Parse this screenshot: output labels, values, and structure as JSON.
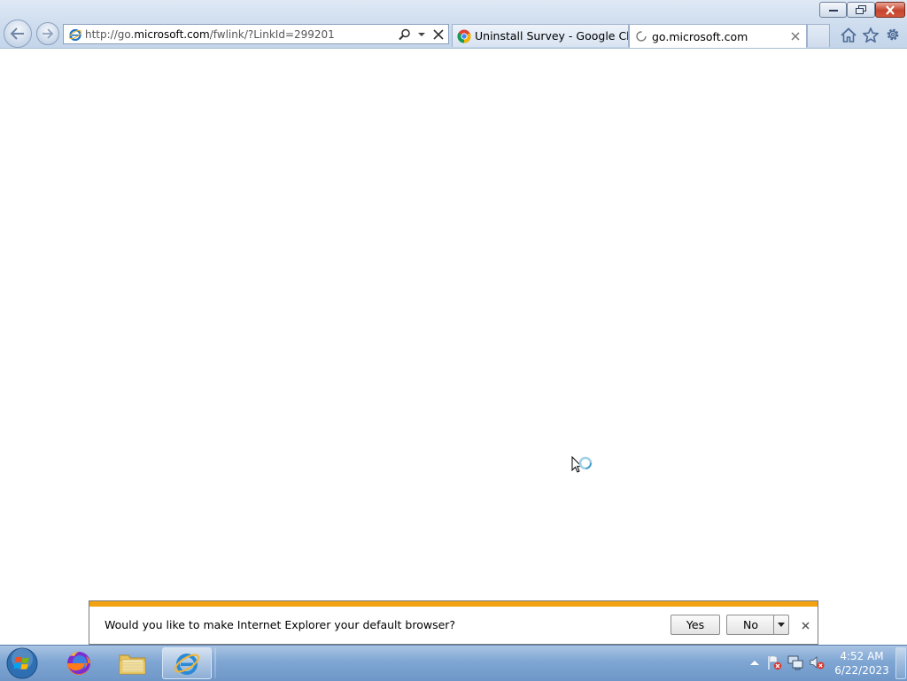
{
  "window": {
    "controls": [
      "minimize",
      "restore",
      "close"
    ]
  },
  "addressbar": {
    "url_prefix": "http://go.",
    "url_domain": "microsoft.com",
    "url_suffix": "/fwlink/?LinkId=299201"
  },
  "tabs": [
    {
      "label": "Uninstall Survey - Google Chr...",
      "icon": "chrome-icon"
    },
    {
      "label": "go.microsoft.com",
      "icon": "loading-icon"
    }
  ],
  "notification": {
    "message": "Would you like to make Internet Explorer your default browser?",
    "yes_label": "Yes",
    "no_label": "No"
  },
  "taskbar": {
    "apps": [
      "firefox-icon",
      "file-explorer-icon",
      "internet-explorer-icon"
    ],
    "time": "4:52 AM",
    "date": "6/22/2023"
  },
  "colors": {
    "notification_stripe": "#f3a312",
    "close_button": "#c6432c"
  }
}
